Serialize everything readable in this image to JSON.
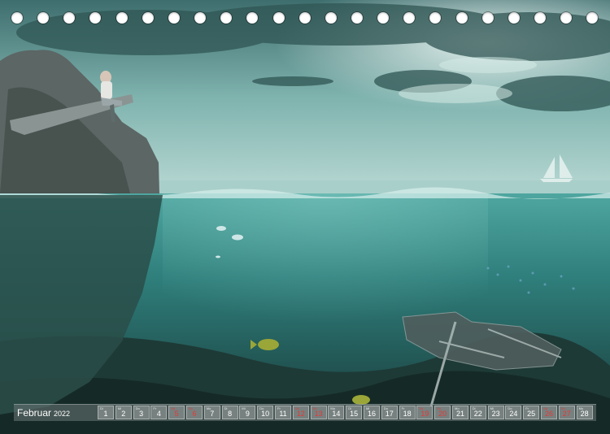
{
  "calendar": {
    "month": "Februar",
    "year": "2022",
    "days": [
      {
        "num": "1",
        "wd": "Di",
        "red": false
      },
      {
        "num": "2",
        "wd": "Mi",
        "red": false
      },
      {
        "num": "3",
        "wd": "Do",
        "red": false
      },
      {
        "num": "4",
        "wd": "Fr",
        "red": false
      },
      {
        "num": "5",
        "wd": "Sa",
        "red": true
      },
      {
        "num": "6",
        "wd": "So",
        "red": true
      },
      {
        "num": "7",
        "wd": "Mo",
        "red": false
      },
      {
        "num": "8",
        "wd": "Di",
        "red": false
      },
      {
        "num": "9",
        "wd": "Mi",
        "red": false
      },
      {
        "num": "10",
        "wd": "Do",
        "red": false
      },
      {
        "num": "11",
        "wd": "Fr",
        "red": false
      },
      {
        "num": "12",
        "wd": "Sa",
        "red": true
      },
      {
        "num": "13",
        "wd": "So",
        "red": true
      },
      {
        "num": "14",
        "wd": "Mo",
        "red": false
      },
      {
        "num": "15",
        "wd": "Di",
        "red": false
      },
      {
        "num": "16",
        "wd": "Mi",
        "red": false
      },
      {
        "num": "17",
        "wd": "Do",
        "red": false
      },
      {
        "num": "18",
        "wd": "Fr",
        "red": false
      },
      {
        "num": "19",
        "wd": "Sa",
        "red": true
      },
      {
        "num": "20",
        "wd": "So",
        "red": true
      },
      {
        "num": "21",
        "wd": "Mo",
        "red": false
      },
      {
        "num": "22",
        "wd": "Di",
        "red": false
      },
      {
        "num": "23",
        "wd": "Mi",
        "red": false
      },
      {
        "num": "24",
        "wd": "Do",
        "red": false
      },
      {
        "num": "25",
        "wd": "Fr",
        "red": false
      },
      {
        "num": "26",
        "wd": "Sa",
        "red": true
      },
      {
        "num": "27",
        "wd": "So",
        "red": true
      },
      {
        "num": "28",
        "wd": "Mo",
        "red": false
      }
    ]
  },
  "colors": {
    "weekend": "#e53935",
    "sky": "#6fa8a4",
    "sea": "#2f7f7c",
    "deep": "#1a3b3a"
  }
}
